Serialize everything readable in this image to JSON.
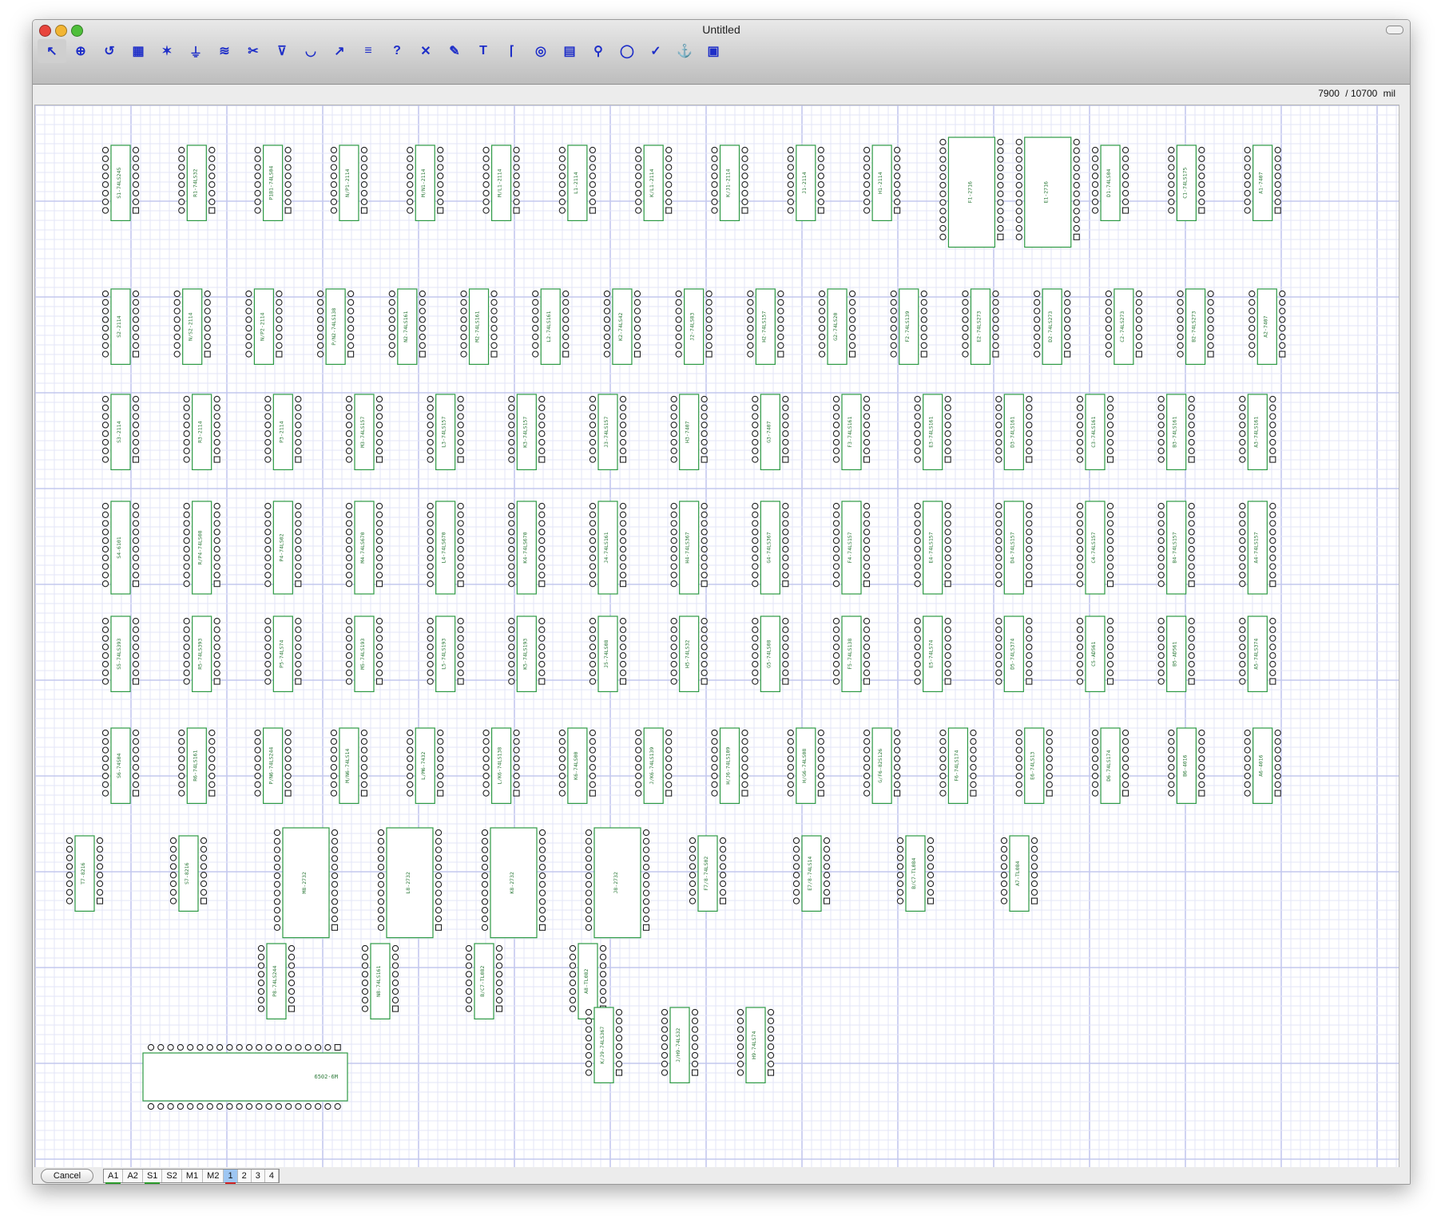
{
  "window": {
    "title": "Untitled"
  },
  "toolbar": {
    "tools": [
      {
        "name": "select-tool",
        "glyph": "↖"
      },
      {
        "name": "zoom-tool",
        "glyph": "⊕"
      },
      {
        "name": "rotate-tool",
        "glyph": "↺"
      },
      {
        "name": "place-part-tool",
        "glyph": "▦"
      },
      {
        "name": "wire-tool",
        "glyph": "✶"
      },
      {
        "name": "ground-tool",
        "glyph": "⏚"
      },
      {
        "name": "bus-tool",
        "glyph": "≋"
      },
      {
        "name": "cut-tool",
        "glyph": "✂"
      },
      {
        "name": "net-tool",
        "glyph": "⊽"
      },
      {
        "name": "via-tool",
        "glyph": "◡"
      },
      {
        "name": "route-tool",
        "glyph": "↗"
      },
      {
        "name": "align-tool",
        "glyph": "≡"
      },
      {
        "name": "help-tool",
        "glyph": "?"
      },
      {
        "name": "delete-tool",
        "glyph": "✕"
      },
      {
        "name": "pencil-tool",
        "glyph": "✎"
      },
      {
        "name": "text-tool",
        "glyph": "T"
      },
      {
        "name": "corner-tool",
        "glyph": "⌈"
      },
      {
        "name": "target-tool",
        "glyph": "◎"
      },
      {
        "name": "grid-tool",
        "glyph": "▤"
      },
      {
        "name": "probe-tool",
        "glyph": "⚲"
      },
      {
        "name": "circle-tool",
        "glyph": "◯"
      },
      {
        "name": "check-tool",
        "glyph": "✓"
      },
      {
        "name": "anchor-tool",
        "glyph": "⚓"
      },
      {
        "name": "chip-tool",
        "glyph": "▣"
      }
    ]
  },
  "coords": {
    "x": "7900",
    "y": "/ 10700",
    "unit": "mil"
  },
  "statusbar": {
    "cancel_label": "Cancel",
    "layers": [
      {
        "label": "A1",
        "active": false,
        "mark": "#2a9a2a"
      },
      {
        "label": "A2",
        "active": false,
        "mark": ""
      },
      {
        "label": "S1",
        "active": false,
        "mark": "#2a9a2a"
      },
      {
        "label": "S2",
        "active": false,
        "mark": ""
      },
      {
        "label": "M1",
        "active": false,
        "mark": ""
      },
      {
        "label": "M2",
        "active": false,
        "mark": ""
      },
      {
        "label": "1",
        "active": true,
        "mark": "#d02020"
      },
      {
        "label": "2",
        "active": false,
        "mark": ""
      },
      {
        "label": "3",
        "active": false,
        "mark": ""
      },
      {
        "label": "4",
        "active": false,
        "mark": ""
      }
    ]
  },
  "colors": {
    "grid_minor": "#e3e5f7",
    "grid_major": "#c4c8ee",
    "outline": "#2d9a44",
    "pin": "#222222",
    "label": "#2d7a3a"
  },
  "board": {
    "rows": [
      {
        "pins": 8,
        "parts": [
          "S1-74LS245",
          "R1-74LS32",
          "P1B1-74LS04",
          "N/P1-2114",
          "M/N1-2114",
          "M/L1-2114",
          "L1-2114",
          "K/L1-2114",
          "K/J1-2114",
          "J1-2114",
          "H1-2114",
          "F1-2716",
          "E1-2716",
          "D1-74LS04",
          "C1-74LS175",
          "A1-7407"
        ]
      },
      {
        "pins": 8,
        "parts": [
          "S2-2114",
          "N/S2-2114",
          "N/P2-2114",
          "P/N2-74LS138",
          "N2-74LS161",
          "M2-74LS161",
          "L2-74LS161",
          "K2-74LS42",
          "J2-74LS83",
          "H2-74LS157",
          "G2-74LS20",
          "F2-74LS139",
          "E2-74LS273",
          "D2-74LS273",
          "C2-74LS273",
          "B2-74LS273",
          "A2-7407"
        ]
      },
      {
        "pins": 8,
        "parts": [
          "S3-2114",
          "R3-2114",
          "P3-2114",
          "M3-74LS157",
          "L3-74LS157",
          "K3-74LS157",
          "J3-74LS157",
          "H3-7407",
          "G3-7407",
          "F3-74LS161",
          "E3-74LS161",
          "D3-74LS161",
          "C3-74LS161",
          "B3-74LS161",
          "A3-74LS161"
        ]
      },
      {
        "pins": 10,
        "parts": [
          "S4-6101",
          "R/P4-74LS08",
          "P4-74LS02",
          "M4-74LS670",
          "L4-74LS670",
          "K4-74LS670",
          "J4-74LS161",
          "H4-74LS367",
          "G4-74LS367",
          "F4-74LS157",
          "E4-74LS157",
          "D4-74LS157",
          "C4-74LS157",
          "B4-74LS157",
          "A4-74LS157"
        ]
      },
      {
        "pins": 8,
        "parts": [
          "S5-74LS393",
          "R5-74LS393",
          "P5-74LS74",
          "M5-74LS193",
          "L5-74LS193",
          "K5-74LS193",
          "J5-74LS08",
          "H5-74LS32",
          "G5-74LS08",
          "F5-74LS138",
          "E5-74LS74",
          "D5-74LS374",
          "C5-AD561",
          "B5-AD561",
          "A5-74LS374"
        ]
      },
      {
        "pins": 8,
        "parts": [
          "S6-74S04",
          "R6-74LS161",
          "P/N6-74LS244",
          "M/N6-74LS14",
          "L/M6-7432",
          "L/K6-74LS138",
          "K6-74LS00",
          "J/K6-74LS139",
          "H/J6-74LS109",
          "H/G6-74LS08",
          "G/F6-82S126",
          "F6-74LS174",
          "E6-74LS13",
          "D6-74LS174",
          "B6-4016",
          "A6-4016"
        ]
      },
      {
        "pins": 8,
        "parts": [
          "T7-8216",
          "S7-8216",
          "M8-2732",
          "L8-2732",
          "K8-2732",
          "J8-2732",
          "F7/8-74LS02",
          "E7/8-74LS14",
          "B/C7-TL084",
          "A7-TL084"
        ]
      },
      {
        "pins": 8,
        "parts": [
          "P8-74LS244",
          "N8-74LS161",
          "B/C7-TL082",
          "A8-TL082"
        ]
      },
      {
        "pins": 8,
        "parts": [
          "K/J9-74LS367",
          "J/H9-74LS32",
          "H9-74LS74"
        ]
      }
    ],
    "cpu": "6502-6M"
  }
}
